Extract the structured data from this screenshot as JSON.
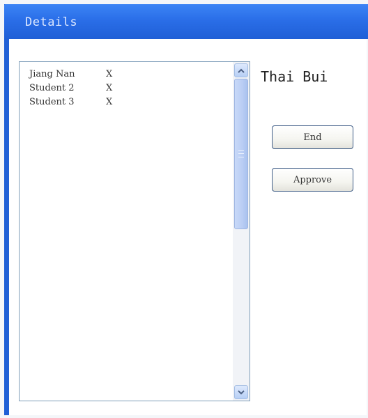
{
  "window": {
    "title": "Details"
  },
  "list": {
    "items": [
      {
        "name": "Jiang Nan",
        "remove": "X"
      },
      {
        "name": "Student 2",
        "remove": "X"
      },
      {
        "name": "Student 3",
        "remove": "X"
      }
    ]
  },
  "detail": {
    "name": "Thai Bui"
  },
  "buttons": {
    "end": "End",
    "approve": "Approve"
  },
  "icons": {
    "scroll_up": "chevron-up-icon",
    "scroll_down": "chevron-down-icon"
  },
  "colors": {
    "titlebar": "#2a6ee8",
    "button_border": "#3e5c86"
  }
}
